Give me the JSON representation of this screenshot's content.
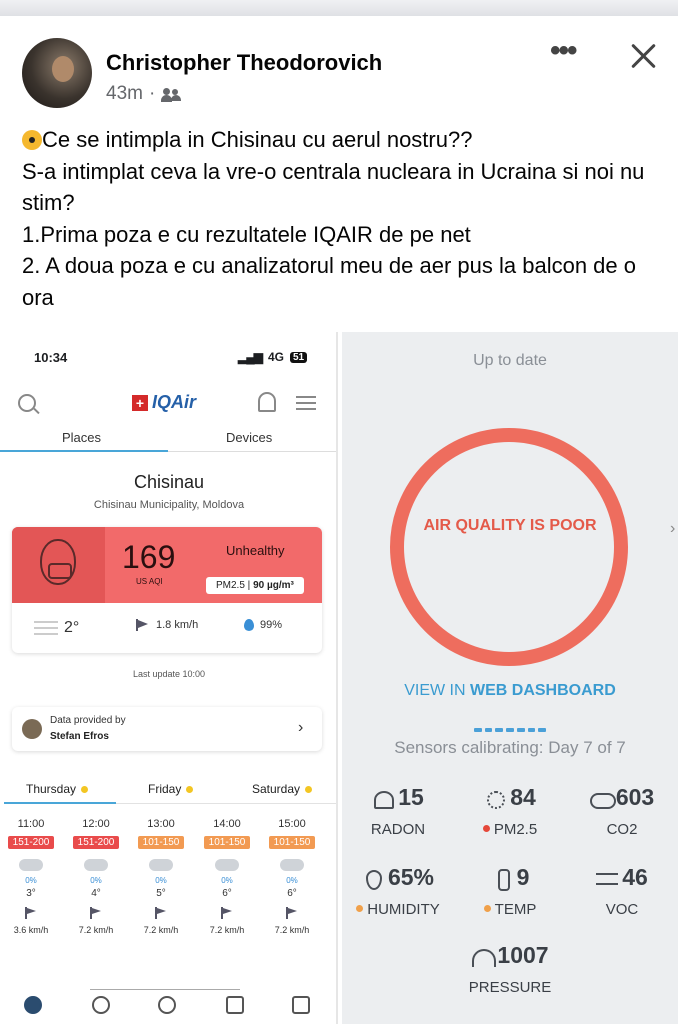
{
  "post": {
    "author": "Christopher Theodorovich",
    "time": "43m",
    "separator": "·",
    "more_label": "•••",
    "lines": [
      "Ce se intimpla in Chisinau cu aerul nostru??",
      "S-a intimplat ceva la vre-o centrala nucleara in Ucraina si noi nu stim?",
      "1.Prima poza e cu rezultatele IQAIR de pe net",
      "2. A doua poza e cu analizatorul meu de aer pus la balcon de o ora"
    ]
  },
  "iqair": {
    "status_time": "10:34",
    "network": "4G",
    "battery": "51",
    "logo_text": "IQAir",
    "logo_cross": "+",
    "tabs": [
      "Places",
      "Devices"
    ],
    "city": "Chisinau",
    "region": "Chisinau Municipality, Moldova",
    "aqi": {
      "value": "169",
      "unit": "US AQI",
      "status": "Unhealthy",
      "pm_label": "PM2.5 |",
      "pm_value": "90 µg/m³",
      "color": "#f26a6a"
    },
    "weather": {
      "temp": "2°",
      "wind": "1.8 km/h",
      "humidity": "99%"
    },
    "last_update": "Last update 10:00",
    "provider": {
      "label": "Data provided by",
      "name": "Stefan Efros",
      "chevron": "›"
    },
    "days": [
      "Thursday",
      "Friday",
      "Saturday"
    ],
    "forecast": [
      {
        "time": "11:00",
        "aqi": "151-200",
        "color": "#e94b4b",
        "precip": "0%",
        "temp": "3°",
        "wind": "3.6 km/h"
      },
      {
        "time": "12:00",
        "aqi": "151-200",
        "color": "#e94b4b",
        "precip": "0%",
        "temp": "4°",
        "wind": "7.2 km/h"
      },
      {
        "time": "13:00",
        "aqi": "101-150",
        "color": "#f29a52",
        "precip": "0%",
        "temp": "5°",
        "wind": "7.2 km/h"
      },
      {
        "time": "14:00",
        "aqi": "101-150",
        "color": "#f29a52",
        "precip": "0%",
        "temp": "6°",
        "wind": "7.2 km/h"
      },
      {
        "time": "15:00",
        "aqi": "101-150",
        "color": "#f29a52",
        "precip": "0%",
        "temp": "6°",
        "wind": "7.2 km/h"
      }
    ],
    "nav_icons": [
      "heart-icon",
      "globe-icon",
      "broadcast-icon",
      "news-icon",
      "cart-icon"
    ]
  },
  "device": {
    "status": "Up to date",
    "quality_label": "AIR QUALITY IS POOR",
    "ring_color": "#ee6d5e",
    "dashboard_prefix": "VIEW IN ",
    "dashboard_bold": "WEB DASHBOARD",
    "calibration": "Sensors calibrating: Day 7 of 7",
    "sensors": [
      {
        "icon": "radon-icon",
        "value": "15",
        "label": "RADON",
        "dot": ""
      },
      {
        "icon": "particles-icon",
        "value": "84",
        "label": "PM2.5",
        "dot": "#e5483a"
      },
      {
        "icon": "cloud-icon",
        "value": "603",
        "label": "CO2",
        "dot": ""
      },
      {
        "icon": "droplet-icon",
        "value": "65%",
        "label": "HUMIDITY",
        "dot": "#f0a04a"
      },
      {
        "icon": "thermometer-icon",
        "value": "9",
        "label": "TEMP",
        "dot": "#f0a04a"
      },
      {
        "icon": "wind-icon",
        "value": "46",
        "label": "VOC",
        "dot": ""
      },
      {
        "icon": "gauge-icon",
        "value": "1007",
        "label": "PRESSURE",
        "dot": ""
      }
    ]
  }
}
